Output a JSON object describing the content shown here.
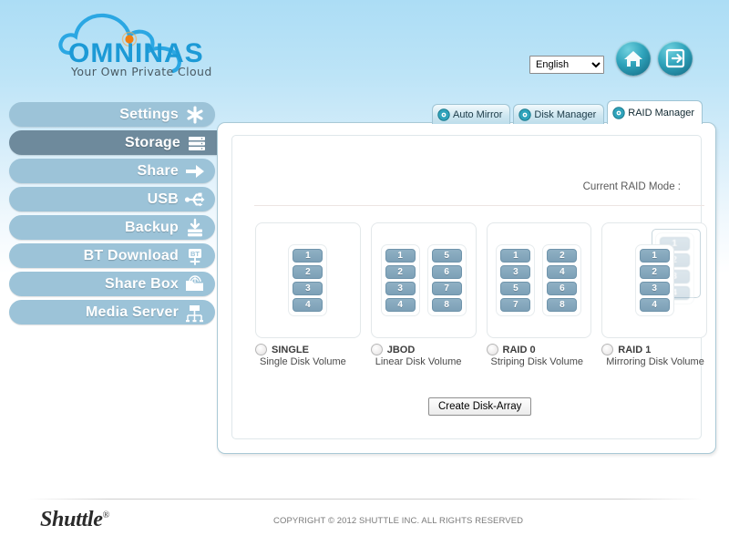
{
  "brand": {
    "logo_text": "OMNINAS",
    "tagline": "Your Own Private Cloud",
    "cloud_icon": "cloud-outline-icon",
    "dot_icon": "orange-dot-icon"
  },
  "header": {
    "language": {
      "selected": "English",
      "options": [
        "English"
      ],
      "icon": "chevron-down-icon"
    },
    "home_icon": "home-icon",
    "logout_icon": "logout-icon"
  },
  "sidebar": {
    "items": [
      {
        "label": "Settings",
        "icon": "gear-asterisk-icon",
        "active": false
      },
      {
        "label": "Storage",
        "icon": "disk-stack-icon",
        "active": true
      },
      {
        "label": "Share",
        "icon": "share-arrow-icon",
        "active": false
      },
      {
        "label": "USB",
        "icon": "usb-icon",
        "active": false
      },
      {
        "label": "Backup",
        "icon": "backup-download-icon",
        "active": false
      },
      {
        "label": "BT Download",
        "icon": "bt-download-icon",
        "active": false
      },
      {
        "label": "Share Box",
        "icon": "share-box-icon",
        "active": false
      },
      {
        "label": "Media Server",
        "icon": "media-server-icon",
        "active": false
      }
    ]
  },
  "tabs": [
    {
      "label": "Auto Mirror",
      "icon": "disk-icon",
      "active": false
    },
    {
      "label": "Disk Manager",
      "icon": "disk-icon",
      "active": false
    },
    {
      "label": "RAID Manager",
      "icon": "disk-icon",
      "active": true
    }
  ],
  "main": {
    "current_mode_label": "Current RAID Mode :",
    "current_mode_value": "",
    "create_button": "Create Disk-Array",
    "raid_modes": [
      {
        "id": "single",
        "title": "SINGLE",
        "subtitle": "Single Disk Volume",
        "selected": false,
        "columns": [
          [
            "1",
            "2",
            "3",
            "4"
          ]
        ],
        "mirror": false
      },
      {
        "id": "jbod",
        "title": "JBOD",
        "subtitle": "Linear Disk Volume",
        "selected": false,
        "columns": [
          [
            "1",
            "2",
            "3",
            "4"
          ],
          [
            "5",
            "6",
            "7",
            "8"
          ]
        ],
        "mirror": false
      },
      {
        "id": "raid0",
        "title": "RAID 0",
        "subtitle": "Striping Disk Volume",
        "selected": false,
        "columns": [
          [
            "1",
            "3",
            "5",
            "7"
          ],
          [
            "2",
            "4",
            "6",
            "8"
          ]
        ],
        "mirror": false
      },
      {
        "id": "raid1",
        "title": "RAID 1",
        "subtitle": "Mirroring Disk Volume",
        "selected": false,
        "columns": [
          [
            "1",
            "2",
            "3",
            "4"
          ]
        ],
        "mirror": true,
        "mirror_column": [
          "1",
          "2",
          "3",
          "4"
        ]
      }
    ]
  },
  "footer": {
    "vendor": "Shuttle",
    "vendor_mark": "®",
    "copyright": "COPYRIGHT © 2012 SHUTTLE INC. ALL RIGHTS RESERVED"
  },
  "colors": {
    "page_top": "#ACDDF5",
    "nav": "#9CC3D8",
    "nav_active": "#6E8A9C",
    "disk_block": "#7DA0B7",
    "accent_teal": "#2FA3BB",
    "logo_blue": "#1C9AD6",
    "logo_dot": "#F07F12"
  }
}
